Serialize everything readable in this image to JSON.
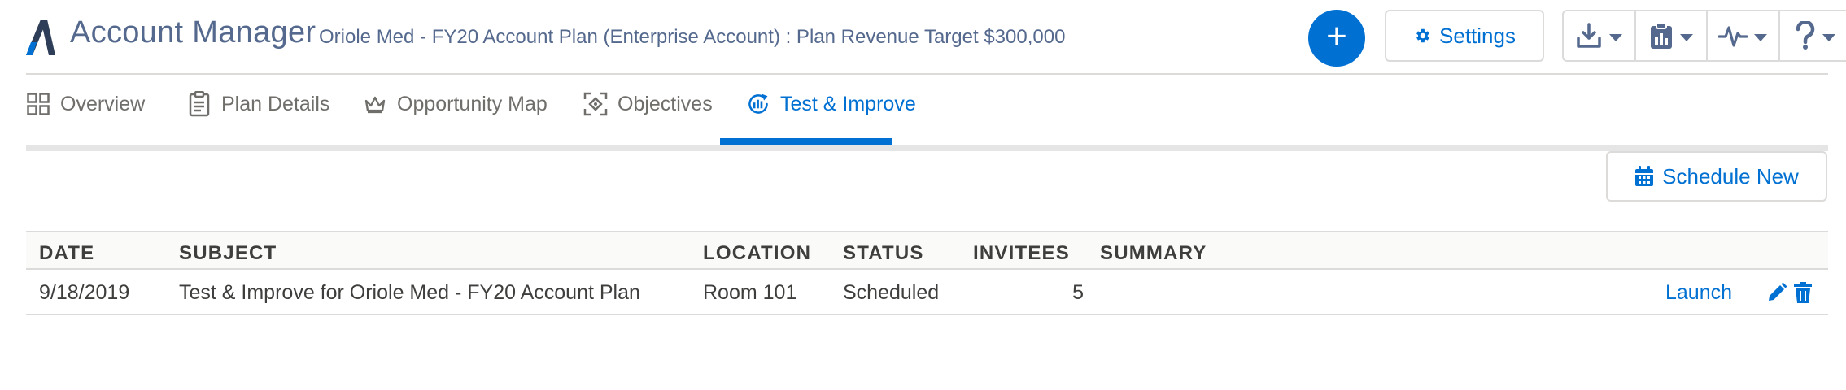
{
  "header": {
    "app_title": "Account Manager",
    "plan_title": "Oriole Med - FY20 Account Plan (Enterprise Account) : Plan Revenue Target $300,000",
    "add_label": "+",
    "settings_label": "Settings",
    "tools": [
      {
        "icon": "download-icon"
      },
      {
        "icon": "clipboard-report-icon"
      },
      {
        "icon": "activity-pulse-icon"
      },
      {
        "icon": "help-question-icon"
      }
    ]
  },
  "tabs": [
    {
      "label": "Overview",
      "icon": "grid-icon",
      "active": false
    },
    {
      "label": "Plan Details",
      "icon": "clipboard-icon",
      "active": false
    },
    {
      "label": "Opportunity Map",
      "icon": "crown-icon",
      "active": false
    },
    {
      "label": "Objectives",
      "icon": "target-icon",
      "active": false
    },
    {
      "label": "Test & Improve",
      "icon": "test-improve-icon",
      "active": true
    }
  ],
  "actions": {
    "schedule_label": "Schedule New"
  },
  "table": {
    "columns": [
      "DATE",
      "SUBJECT",
      "LOCATION",
      "STATUS",
      "INVITEES",
      "SUMMARY"
    ],
    "rows": [
      {
        "date": "9/18/2019",
        "subject": "Test & Improve for Oriole Med - FY20 Account Plan",
        "location": "Room 101",
        "status": "Scheduled",
        "invitees": "5",
        "summary": "",
        "launch_label": "Launch"
      }
    ]
  },
  "colors": {
    "brand": "#0070d2",
    "text": "#3e3e3c",
    "muted": "#706e6b",
    "border": "#dddbda",
    "title": "#54698d"
  }
}
